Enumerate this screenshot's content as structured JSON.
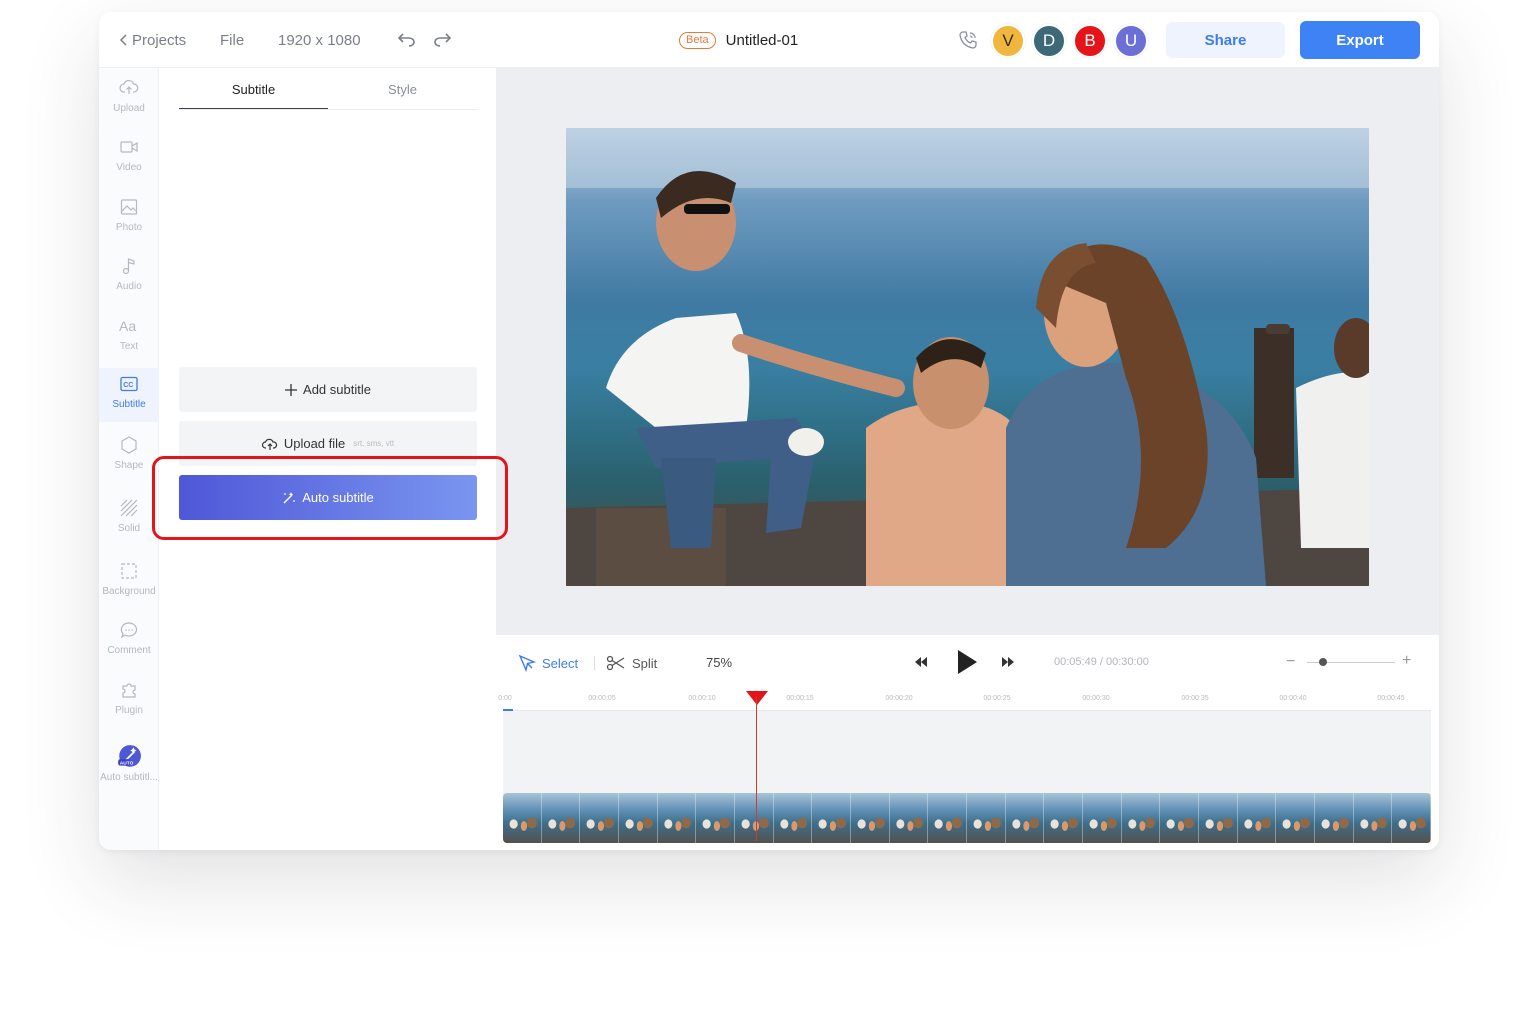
{
  "topbar": {
    "projects_label": "Projects",
    "file_label": "File",
    "resolution": "1920 x 1080",
    "beta_badge": "Beta",
    "doc_title": "Untitled-01",
    "avatars": [
      {
        "letter": "V",
        "color": "#f0b63e"
      },
      {
        "letter": "D",
        "color": "#3c6878"
      },
      {
        "letter": "B",
        "color": "#e4141a"
      },
      {
        "letter": "U",
        "color": "#6b6fd6"
      }
    ],
    "share_label": "Share",
    "export_label": "Export"
  },
  "rail": {
    "items": [
      {
        "label": "Upload",
        "icon": "cloud-upload-icon"
      },
      {
        "label": "Video",
        "icon": "video-camera-icon"
      },
      {
        "label": "Photo",
        "icon": "image-icon"
      },
      {
        "label": "Audio",
        "icon": "music-note-icon"
      },
      {
        "label": "Text",
        "icon": "text-aa-icon"
      },
      {
        "label": "Subtitle",
        "icon": "cc-icon",
        "active": true
      },
      {
        "label": "Shape",
        "icon": "hexagon-icon"
      },
      {
        "label": "Solid",
        "icon": "stripes-icon"
      },
      {
        "label": "Background",
        "icon": "dashed-square-icon"
      },
      {
        "label": "Comment",
        "icon": "chat-bubble-icon"
      },
      {
        "label": "Plugin",
        "icon": "puzzle-icon"
      },
      {
        "label": "Auto subtitl...",
        "icon": "auto-magic-icon"
      }
    ]
  },
  "panel": {
    "tabs": [
      "Subtitle",
      "Style"
    ],
    "add_subtitle_label": "Add subtitle",
    "upload_file_label": "Upload file",
    "upload_formats": "srt, sms, vtt",
    "auto_subtitle_label": "Auto subtitle"
  },
  "timeline": {
    "select_label": "Select",
    "split_label": "Split",
    "zoom_level": "75%",
    "time_display": "00:05:49 / 00:30:00",
    "zoom_slider_value": 0.18,
    "ruler_ticks": [
      "0:00",
      "00:00:05",
      "00:00:10",
      "00:00:15",
      "00:00:20",
      "00:00:25",
      "00:00:30",
      "00:00:35",
      "00:00:40",
      "00:00:45"
    ],
    "accent_color": "#3d7cf0",
    "playhead_color": "#d33b2c"
  }
}
